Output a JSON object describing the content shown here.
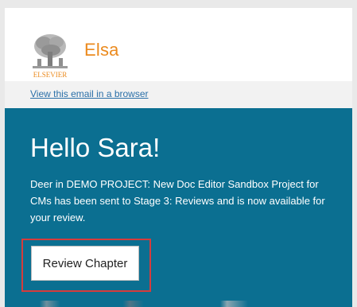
{
  "header": {
    "logo_icon": "elsevier-tree-logo",
    "logo_wordmark": "ELSEVIER",
    "brand_name": "Elsa"
  },
  "browser_link": "View this email in a browser",
  "hero": {
    "greeting": "Hello Sara!",
    "message": "Deer in DEMO PROJECT: New Doc Editor Sandbox Project for CMs has been sent to Stage 3: Reviews and is now available for your review.",
    "cta_label": "Review Chapter"
  },
  "colors": {
    "brand_orange": "#eb8a1e",
    "hero_teal": "#0b6f91",
    "link_blue": "#2a6fa8",
    "highlight_red": "#d63c3c"
  }
}
